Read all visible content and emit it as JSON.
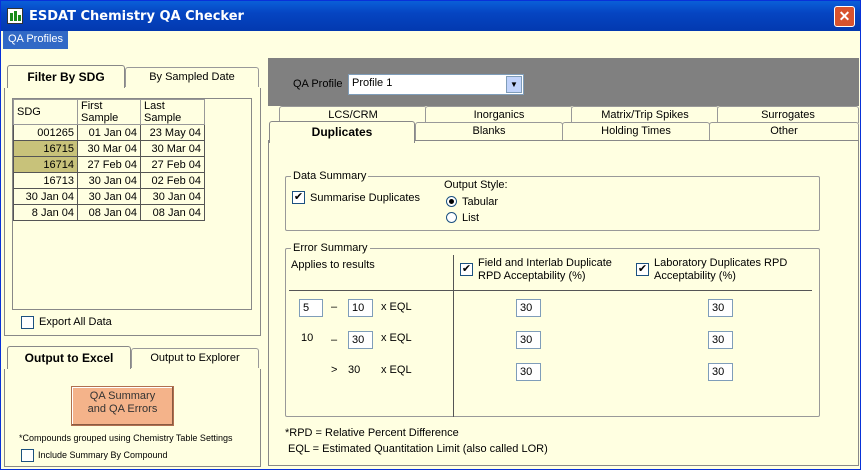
{
  "window": {
    "title": "ESDAT Chemistry QA Checker",
    "close_glyph": "✕"
  },
  "menu": {
    "qa_profiles": "QA Profiles"
  },
  "filter": {
    "tabs": [
      "Filter By SDG",
      "By Sampled Date"
    ],
    "columns": [
      "SDG",
      "First Sample",
      "Last Sample"
    ],
    "rows": [
      {
        "sdg": "001265",
        "first": "01 Jan 04",
        "last": "23 May 04",
        "selected": false
      },
      {
        "sdg": "16715",
        "first": "30 Mar 04",
        "last": "30 Mar 04",
        "selected": true
      },
      {
        "sdg": "16714",
        "first": "27 Feb 04",
        "last": "27 Feb 04",
        "selected": true
      },
      {
        "sdg": "16713",
        "first": "30 Jan 04",
        "last": "02 Feb 04",
        "selected": false
      },
      {
        "sdg": "30 Jan 04",
        "first": "30 Jan 04",
        "last": "30 Jan 04",
        "selected": false
      },
      {
        "sdg": "8 Jan 04",
        "first": "08 Jan 04",
        "last": "08 Jan 04",
        "selected": false
      }
    ],
    "export_all": "Export All Data"
  },
  "output": {
    "tabs": [
      "Output to Excel",
      "Output to Explorer"
    ],
    "qa_button": "QA Summary and QA Errors",
    "note": "*Compounds grouped using Chemistry Table Settings",
    "include_summary": "Include Summary By Compound"
  },
  "profile": {
    "label": "QA Profile",
    "value": "Profile 1"
  },
  "main_tabs": {
    "top": [
      "LCS/CRM",
      "Inorganics",
      "Matrix/Trip Spikes",
      "Surrogates"
    ],
    "bottom": [
      "Duplicates",
      "Blanks",
      "Holding Times",
      "Other"
    ]
  },
  "data_summary": {
    "legend": "Data Summary",
    "summarise": "Summarise Duplicates",
    "output_style": "Output Style:",
    "tabular": "Tabular",
    "list": "List"
  },
  "error_summary": {
    "legend": "Error Summary",
    "applies": "Applies to results",
    "field_header": "Field and Interlab Duplicate RPD Acceptability (%)",
    "lab_header": "Laboratory Duplicates RPD Acceptability (%)",
    "dash": "–",
    "gt": ">",
    "xeql": "x EQL",
    "range1_low": "5",
    "range1_high": "10",
    "range2_low": "10",
    "range2_high": "30",
    "range3": "30",
    "field_values": [
      "30",
      "30",
      "30"
    ],
    "lab_values": [
      "30",
      "30",
      "30"
    ]
  },
  "footnotes": {
    "rpd": "*RPD = Relative Percent Difference",
    "eql": "EQL = Estimated Quantitation Limit (also called LOR)"
  }
}
